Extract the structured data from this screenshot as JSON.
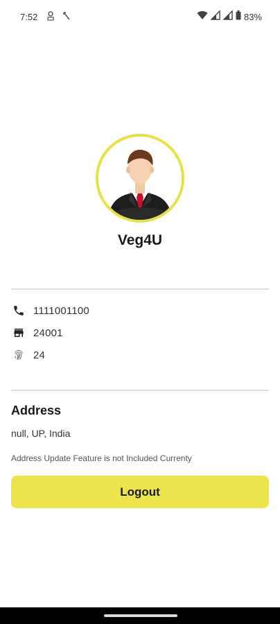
{
  "status_bar": {
    "time": "7:52",
    "battery": "83%",
    "icons": [
      "notification-icon",
      "missed-call-icon",
      "wifi-icon",
      "signal-icon",
      "signal-icon",
      "battery-icon"
    ]
  },
  "profile": {
    "avatar_icon": "businessman-avatar-icon",
    "name": "Veg4U",
    "accent_color": "#e8e04a"
  },
  "details": {
    "phone": {
      "icon": "phone-icon",
      "value": "1111001100"
    },
    "store": {
      "icon": "store-icon",
      "value": "24001"
    },
    "id": {
      "icon": "fingerprint-icon",
      "value": "24"
    }
  },
  "address": {
    "title": "Address",
    "value": "null, UP, India",
    "note": "Address Update Feature is not Included Currenty"
  },
  "logout": {
    "label": "Logout",
    "color": "#ece44c"
  }
}
